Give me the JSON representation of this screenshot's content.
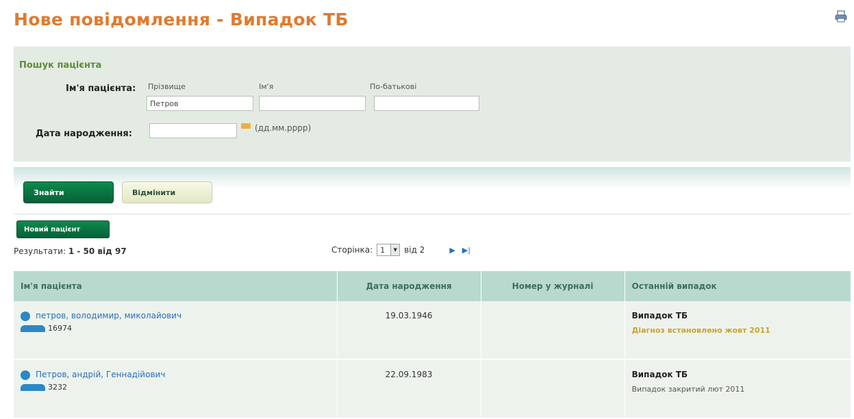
{
  "page": {
    "title": "Нове повідомлення - Випадок ТБ",
    "print_icon": "printer-icon"
  },
  "search": {
    "heading": "Пошук пацієнта",
    "patient_name_label": "Ім'я пацієнта:",
    "surname_label": "Прізвище",
    "firstname_label": "Ім'я",
    "patronymic_label": "По-батькові",
    "surname_value": "Петров",
    "firstname_value": "",
    "patronymic_value": "",
    "dob_label": "Дата народження:",
    "dob_value": "",
    "dob_hint": "(дд.мм.рррр)"
  },
  "actions": {
    "find_label": "Знайти",
    "cancel_label": "Відмінити",
    "new_patient_label": "Новий пацієнт"
  },
  "results": {
    "prefix": "Результати:",
    "range": "1 - 50 від 97"
  },
  "pager": {
    "label": "Сторінка:",
    "current": "1",
    "of_text": "від 2"
  },
  "table": {
    "headers": [
      "Ім'я пацієнта",
      "Дата народження",
      "Номер у журналі",
      "Останній випадок"
    ],
    "rows": [
      {
        "name": "петров, володимир, миколайович",
        "id": "16974",
        "dob": "19.03.1946",
        "journal": "",
        "case_title": "Випадок ТБ",
        "case_status": "Діагноз встановлено жовт 2011"
      },
      {
        "name": "Петров, андрій, Геннадійович",
        "id": "3232",
        "dob": "22.09.1983",
        "journal": "",
        "case_title": "Випадок ТБ",
        "case_status": "Випадок закритий лют 2011"
      }
    ]
  },
  "colors": {
    "title": "#e07a2e",
    "panel": "#e3ebe3",
    "primary_button": "#0e8a4c",
    "header_bg": "#b9d9ce",
    "link": "#2a6ebb",
    "warn": "#c8a233"
  }
}
